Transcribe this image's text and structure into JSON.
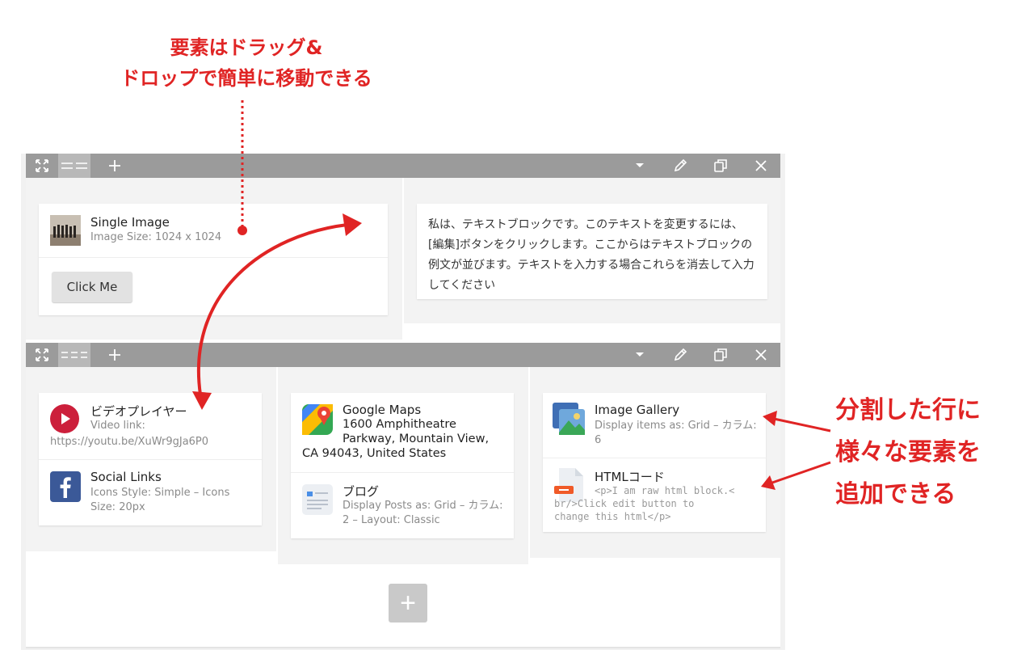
{
  "annotations": {
    "top_line1": "要素はドラッグ&",
    "top_line2": "ドロップで簡単に移動できる",
    "right_line1": "分割した行に",
    "right_line2": "様々な要素を",
    "right_line3": "追加できる"
  },
  "colors": {
    "annotation": "#e02424",
    "toolbar": "#9b9b9b",
    "toolbar_active": "#b8b8b8",
    "column_bg": "#f3f3f3",
    "youtube_red": "#cc1f3b",
    "facebook_blue": "#3b5998"
  },
  "row1": {
    "toolbar": {
      "icons": [
        "move-icon",
        "layout-columns-icon",
        "add-column-icon",
        "dropdown-icon",
        "edit-icon",
        "duplicate-icon",
        "close-icon"
      ]
    },
    "single_image": {
      "title": "Single Image",
      "subtitle": "Image Size: 1024 x 1024"
    },
    "button": {
      "label": "Click Me"
    },
    "text_block": {
      "content": "私は、テキストブロックです。このテキストを変更するには、[編集]ボタンをクリックします。ここからはテキストブロックの例文が並びます。テキストを入力する場合これらを消去して入力してください"
    }
  },
  "row2": {
    "video": {
      "title": "ビデオプレイヤー",
      "sub1": "Video link:",
      "sub2": "https://youtu.be/XuWr9gJa6P0"
    },
    "social": {
      "title": "Social Links",
      "sub1": "Icons Style: Simple – Icons",
      "sub2": "Size: 20px"
    },
    "maps": {
      "title": "Google Maps",
      "line1": "1600 Amphitheatre",
      "line2": "Parkway, Mountain View,",
      "line3": "CA 94043, United States"
    },
    "blog": {
      "title": "ブログ",
      "sub1": "Display Posts as: Grid – カラム:",
      "sub2": "2 – Layout: Classic"
    },
    "gallery": {
      "title": "Image Gallery",
      "sub1": "Display items as: Grid – カラム:",
      "sub2": "6"
    },
    "html": {
      "title": "HTMLコード",
      "line1": "<p>I am raw html block.<",
      "line2": "br/>Click edit button to",
      "line3": "change this html</p>"
    }
  },
  "add_row_button": "+"
}
